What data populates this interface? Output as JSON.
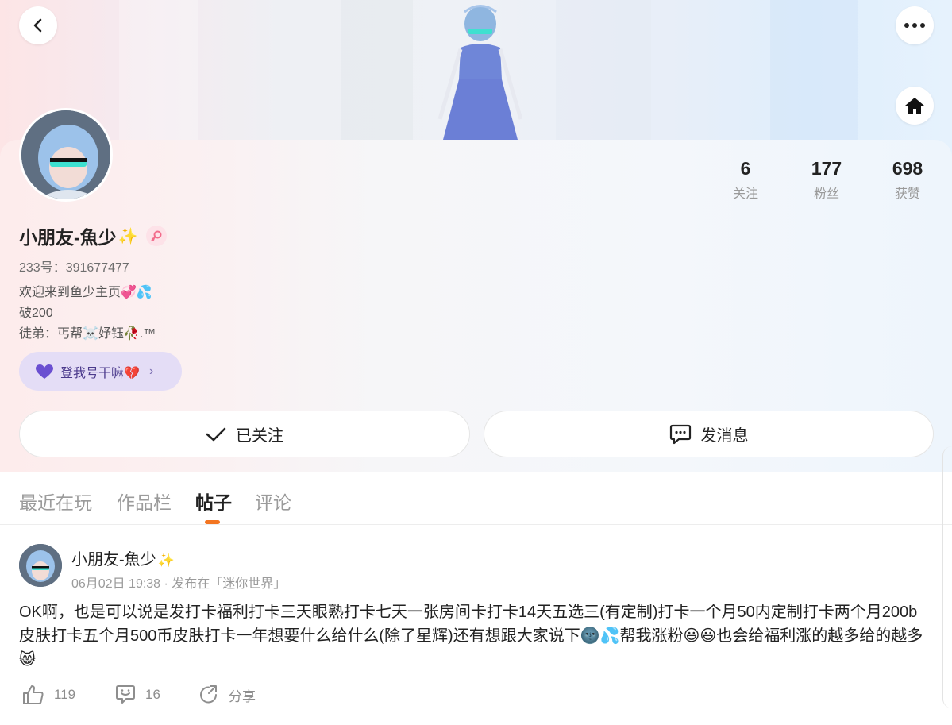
{
  "header": {
    "back_icon": "chevron-left-icon",
    "more_icon": "ellipsis-icon",
    "home_icon": "home-icon"
  },
  "profile": {
    "stats": [
      {
        "num": "6",
        "label": "关注"
      },
      {
        "num": "177",
        "label": "粉丝"
      },
      {
        "num": "698",
        "label": "获赞"
      }
    ],
    "nickname": "小朋友-魚少",
    "sparkle": "✨",
    "uid": "233号：391677477",
    "bio_lines": [
      "欢迎来到鱼少主页💞💦",
      "破200",
      "徒弟：丐帮☠️妤钰🥀.™"
    ],
    "tag_pill": {
      "icon": "purple-heart-icon",
      "label": "登我号干嘛💔"
    },
    "follow_button": "已关注",
    "message_button": "发消息"
  },
  "tabs": [
    "最近在玩",
    "作品栏",
    "帖子",
    "评论"
  ],
  "active_tab": "帖子",
  "post": {
    "author": "小朋友-魚少",
    "author_sparkle": "✨",
    "meta": "06月02日 19:38 · 发布在「迷你世界」",
    "body": "OK啊，也是可以说是发打卡福利打卡三天眼熟打卡七天一张房间卡打卡14天五选三(有定制)打卡一个月50内定制打卡两个月200b皮肤打卡五个月500币皮肤打卡一年想要什么给什么(除了星辉)还有想跟大家说下🌚💦帮我涨粉😃😃也会给福利涨的越多给的越多😸",
    "likes": "119",
    "comments": "16",
    "share": "分享"
  },
  "colors": {
    "accent": "#f37521",
    "pill_bg": "#e4ddf6",
    "pill_text": "#4b3a8c"
  }
}
